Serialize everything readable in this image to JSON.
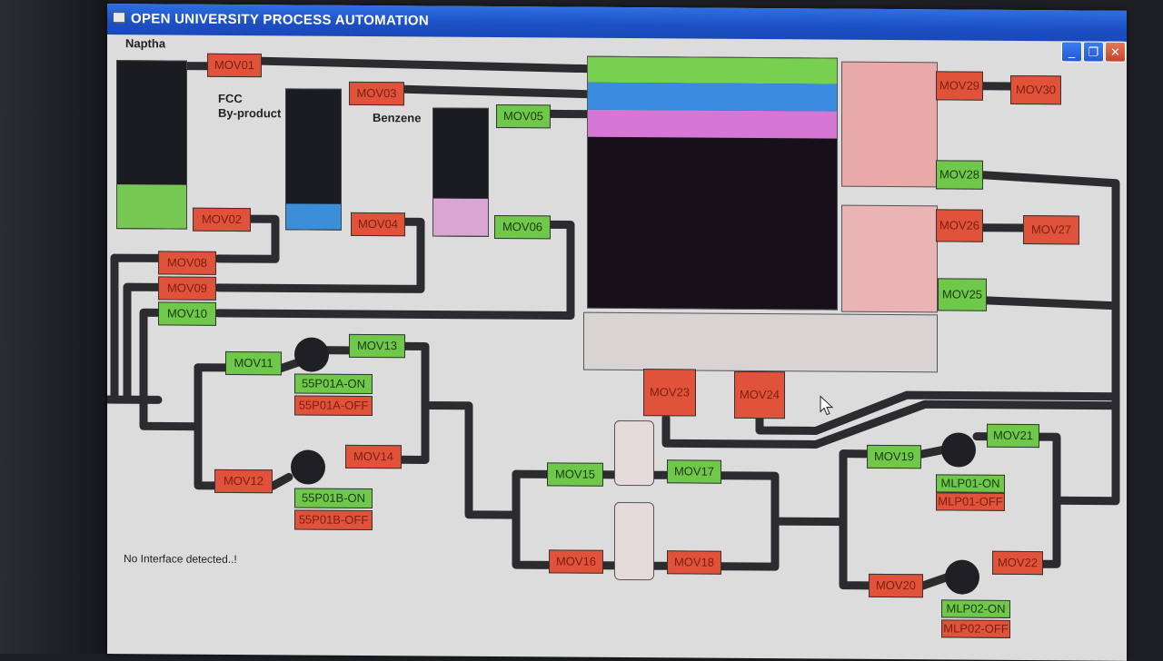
{
  "window": {
    "title": "OPEN UNIVERSITY PROCESS AUTOMATION",
    "minimize": "_",
    "restore": "❐",
    "close": "✕"
  },
  "labels": {
    "naptha": "Naptha",
    "fcc": "FCC",
    "byproduct": "By-product",
    "benzene": "Benzene"
  },
  "valves": {
    "mov01": "MOV01",
    "mov02": "MOV02",
    "mov03": "MOV03",
    "mov04": "MOV04",
    "mov05": "MOV05",
    "mov06": "MOV06",
    "mov08": "MOV08",
    "mov09": "MOV09",
    "mov10": "MOV10",
    "mov11": "MOV11",
    "mov12": "MOV12",
    "mov13": "MOV13",
    "mov14": "MOV14",
    "mov15": "MOV15",
    "mov16": "MOV16",
    "mov17": "MOV17",
    "mov18": "MOV18",
    "mov19": "MOV19",
    "mov20": "MOV20",
    "mov21": "MOV21",
    "mov22": "MOV22",
    "mov23": "MOV23",
    "mov24": "MOV24",
    "mov25": "MOV25",
    "mov26": "MOV26",
    "mov27": "MOV27",
    "mov28": "MOV28",
    "mov29": "MOV29",
    "mov30": "MOV30"
  },
  "pumps": {
    "p55p01a_on": "55P01A-ON",
    "p55p01a_off": "55P01A-OFF",
    "p55p01b_on": "55P01B-ON",
    "p55p01b_off": "55P01B-OFF",
    "mlp01_on": "MLP01-ON",
    "mlp01_off": "MLP01-OFF",
    "mlp02_on": "MLP02-ON",
    "mlp02_off": "MLP02-OFF"
  },
  "status": "No Interface detected..!",
  "colors": {
    "valve_open": "#6fc84a",
    "valve_closed": "#e0533a",
    "naptha_level": "#76c852",
    "fcc_level": "#3a8fd8",
    "benzene_level": "#d9a6d4",
    "titlebar": "#1c4fc4"
  },
  "levels": {
    "naptha": 0.26,
    "fcc_byproduct": 0.23,
    "benzene": 0.29
  }
}
